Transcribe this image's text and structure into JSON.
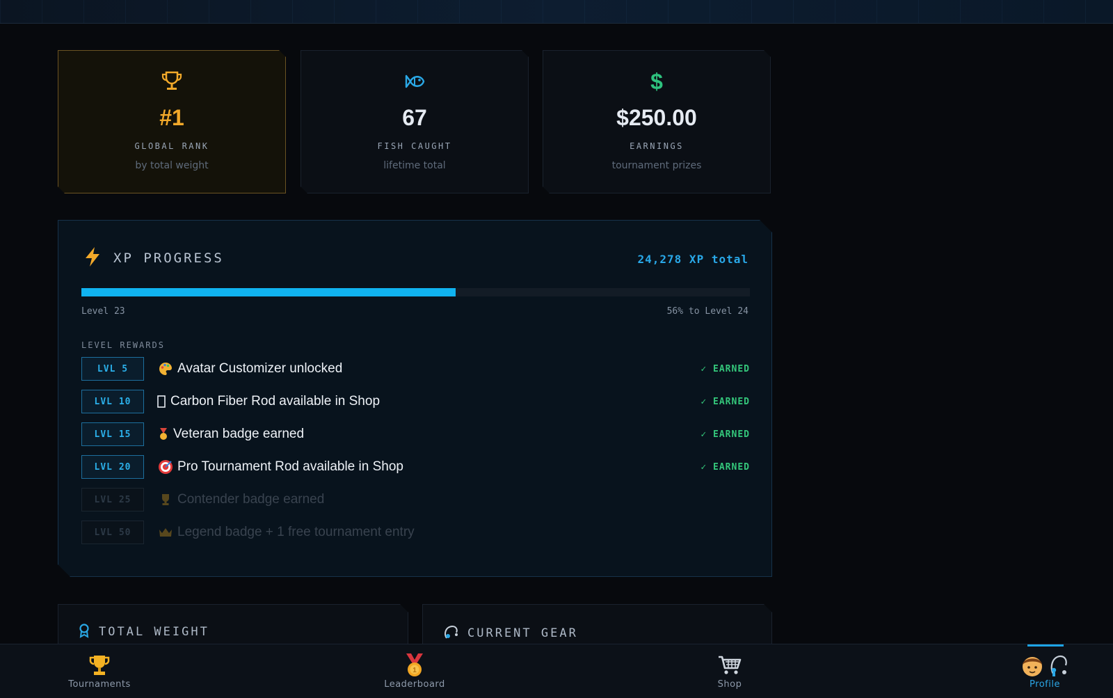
{
  "stats": {
    "rank": {
      "value": "#1",
      "label": "GLOBAL RANK",
      "sub": "by total weight",
      "icon": "trophy-icon"
    },
    "fish": {
      "value": "67",
      "label": "FISH CAUGHT",
      "sub": "lifetime total",
      "icon": "fish-icon"
    },
    "earnings": {
      "value": "$250.00",
      "label": "EARNINGS",
      "sub": "tournament prizes",
      "icon": "dollar-icon"
    }
  },
  "xp": {
    "title": "XP PROGRESS",
    "total": "24,278 XP total",
    "progress_fraction": 0.56,
    "level_current": "Level 23",
    "level_next": "56% to Level 24",
    "rewards_title": "LEVEL REWARDS",
    "rewards": [
      {
        "level": "LVL 5",
        "icon": "palette-icon",
        "text": "Avatar Customizer unlocked",
        "status": "✓ EARNED",
        "earned": true
      },
      {
        "level": "LVL 10",
        "icon": "rod-icon",
        "text": "Carbon Fiber Rod available in Shop",
        "status": "✓ EARNED",
        "earned": true
      },
      {
        "level": "LVL 15",
        "icon": "medal-icon",
        "text": "Veteran badge earned",
        "status": "✓ EARNED",
        "earned": true
      },
      {
        "level": "LVL 20",
        "icon": "target-icon",
        "text": "Pro Tournament Rod available in Shop",
        "status": "✓ EARNED",
        "earned": true
      },
      {
        "level": "LVL 25",
        "icon": "trophy-icon",
        "text": "Contender badge earned",
        "status": "",
        "earned": false
      },
      {
        "level": "LVL 50",
        "icon": "crown-icon",
        "text": "Legend badge + 1 free tournament entry",
        "status": "",
        "earned": false
      }
    ]
  },
  "sections": {
    "weight_title": "TOTAL WEIGHT",
    "gear_title": "CURRENT GEAR"
  },
  "nav": [
    {
      "label": "Tournaments",
      "icon": "trophy-icon"
    },
    {
      "label": "Leaderboard",
      "icon": "medal-icon"
    },
    {
      "label": "Shop",
      "icon": "cart-icon"
    },
    {
      "label": "Profile",
      "icon": "avatar-icon",
      "active": true
    }
  ],
  "colors": {
    "accent": "#10b3f0",
    "gold": "#f2a92a",
    "earned": "#34c77b",
    "money": "#2ec27e"
  }
}
